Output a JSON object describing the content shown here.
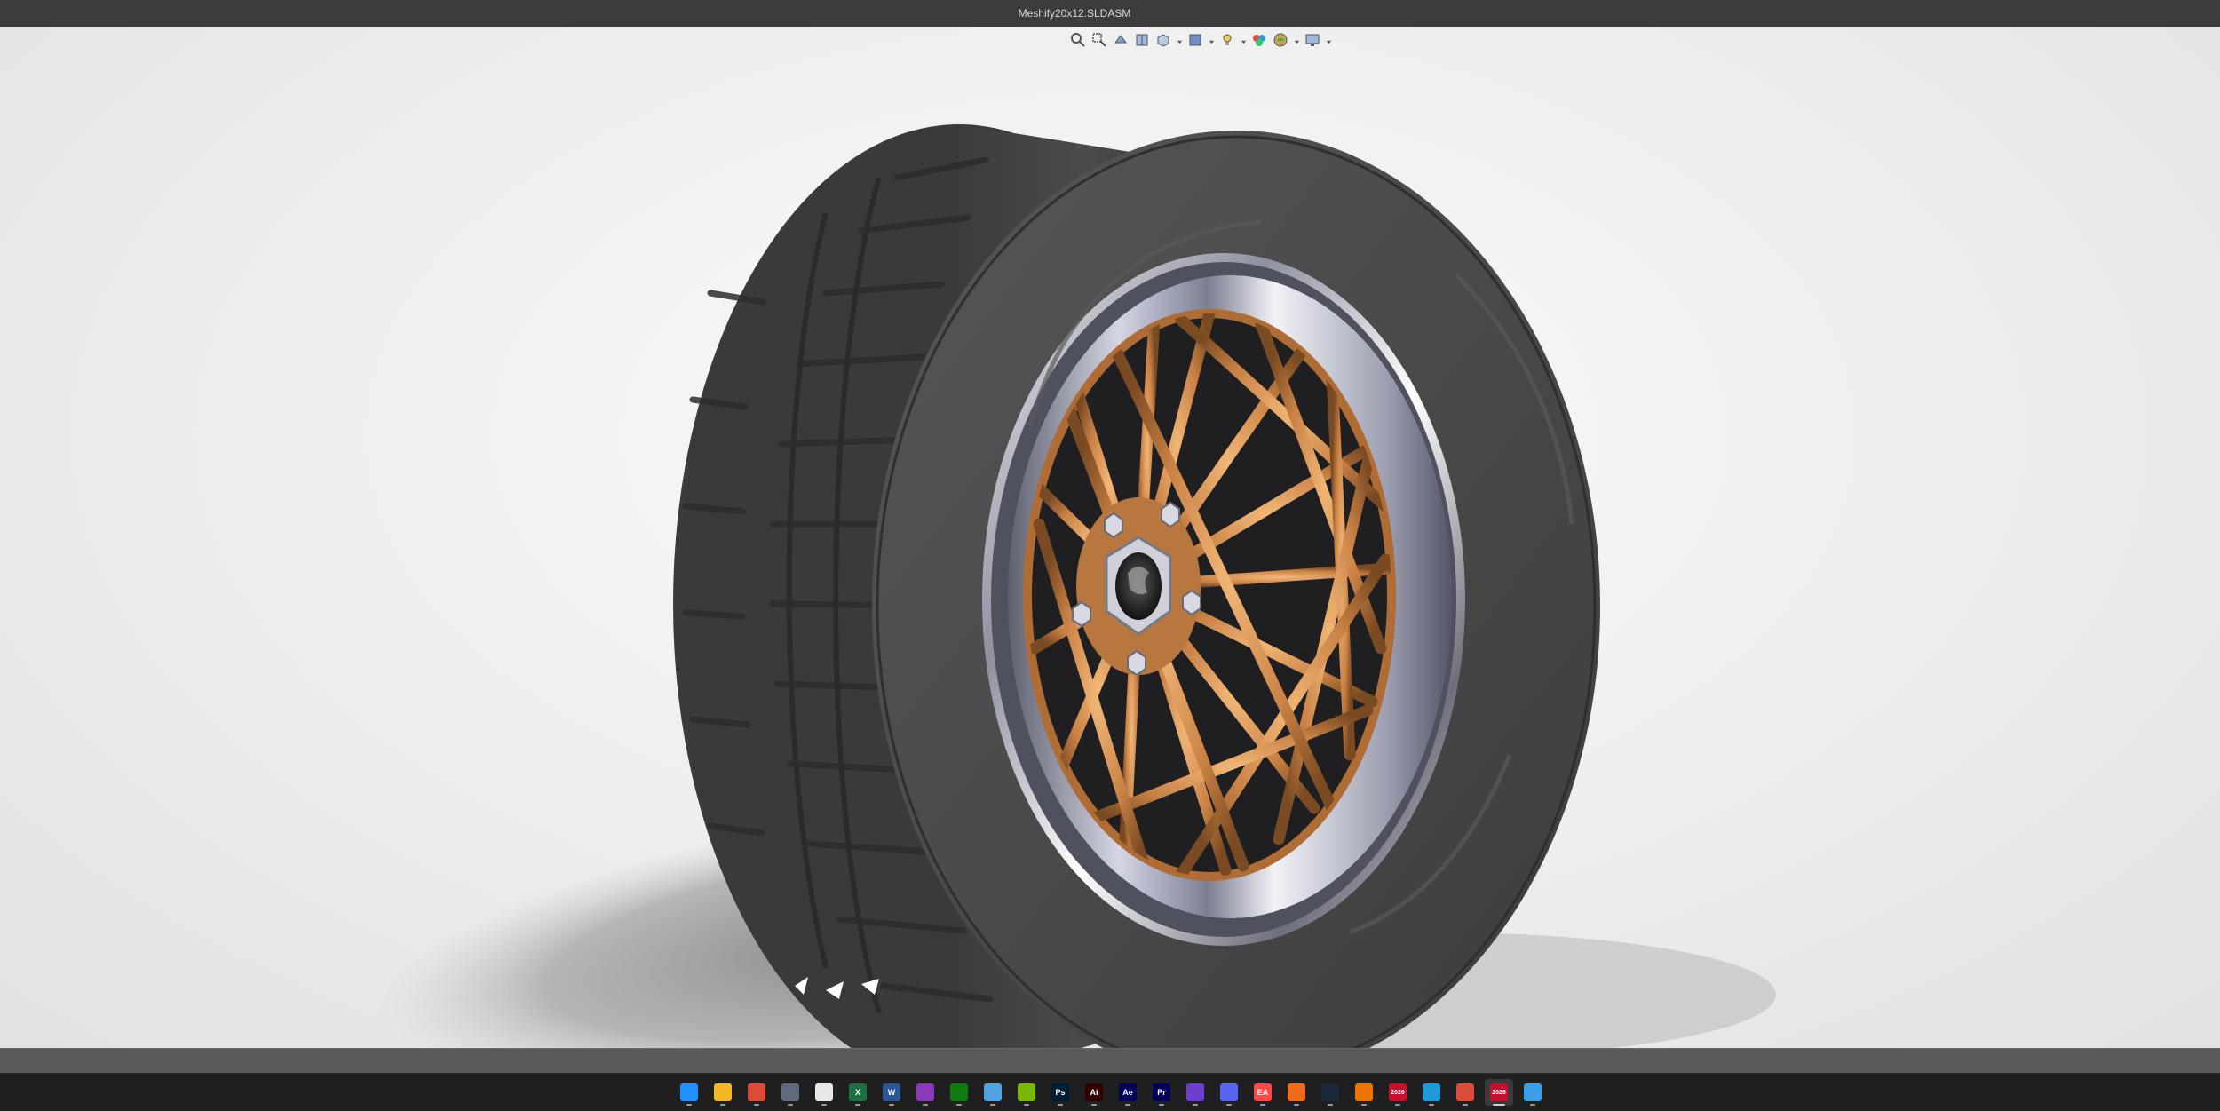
{
  "window": {
    "title": "Meshify20x12.SLDASM"
  },
  "heads_up_toolbar": [
    {
      "name": "zoom-to-fit-icon",
      "dropdown": false
    },
    {
      "name": "zoom-to-area-icon",
      "dropdown": false
    },
    {
      "name": "previous-view-icon",
      "dropdown": false
    },
    {
      "name": "section-view-icon",
      "dropdown": false
    },
    {
      "name": "view-orientation-icon",
      "dropdown": true
    },
    {
      "name": "display-style-icon",
      "dropdown": true
    },
    {
      "name": "hide-show-items-icon",
      "dropdown": true
    },
    {
      "name": "edit-appearance-icon",
      "dropdown": false
    },
    {
      "name": "apply-scene-icon",
      "dropdown": true
    },
    {
      "name": "view-settings-icon",
      "dropdown": true
    }
  ],
  "taskbar": {
    "icons": [
      {
        "name": "start-icon",
        "text": "",
        "color": "#1e90ff"
      },
      {
        "name": "file-explorer-icon",
        "text": "",
        "color": "#f2b824"
      },
      {
        "name": "chrome-icon",
        "text": "",
        "color": "#dd4b39"
      },
      {
        "name": "calculator-icon",
        "text": "",
        "color": "#5f6b7a"
      },
      {
        "name": "microsoft-store-icon",
        "text": "",
        "color": "#e8e8e8"
      },
      {
        "name": "excel-icon",
        "text": "X",
        "color": "#1d7044"
      },
      {
        "name": "word-icon",
        "text": "W",
        "color": "#2b5797"
      },
      {
        "name": "instagram-icon",
        "text": "",
        "color": "#8a3ab9"
      },
      {
        "name": "xbox-icon",
        "text": "",
        "color": "#107c10"
      },
      {
        "name": "notes-icon",
        "text": "",
        "color": "#4fa3e0"
      },
      {
        "name": "nvidia-icon",
        "text": "",
        "color": "#76b900"
      },
      {
        "name": "photoshop-icon",
        "text": "Ps",
        "color": "#001e36"
      },
      {
        "name": "illustrator-icon",
        "text": "Ai",
        "color": "#330000"
      },
      {
        "name": "after-effects-icon",
        "text": "Ae",
        "color": "#00005b"
      },
      {
        "name": "premiere-icon",
        "text": "Pr",
        "color": "#00005b"
      },
      {
        "name": "mail-icon",
        "text": "",
        "color": "#6c3fd1"
      },
      {
        "name": "discord-icon",
        "text": "",
        "color": "#5865f2"
      },
      {
        "name": "ea-icon",
        "text": "EA",
        "color": "#ff4747"
      },
      {
        "name": "fusion-icon",
        "text": "",
        "color": "#f26b1d"
      },
      {
        "name": "steam-icon",
        "text": "",
        "color": "#1b2838"
      },
      {
        "name": "blender-icon",
        "text": "",
        "color": "#ea7600"
      },
      {
        "name": "solidworks-icon",
        "text": "2026",
        "color": "#c8102e"
      },
      {
        "name": "box-icon",
        "text": "",
        "color": "#1d9bd8"
      },
      {
        "name": "chrome-icon-2",
        "text": "",
        "color": "#dd4b39"
      },
      {
        "name": "solidworks-icon-2",
        "text": "2026",
        "color": "#c8102e"
      },
      {
        "name": "notepad-icon",
        "text": "",
        "color": "#3aa0e8"
      }
    ]
  }
}
